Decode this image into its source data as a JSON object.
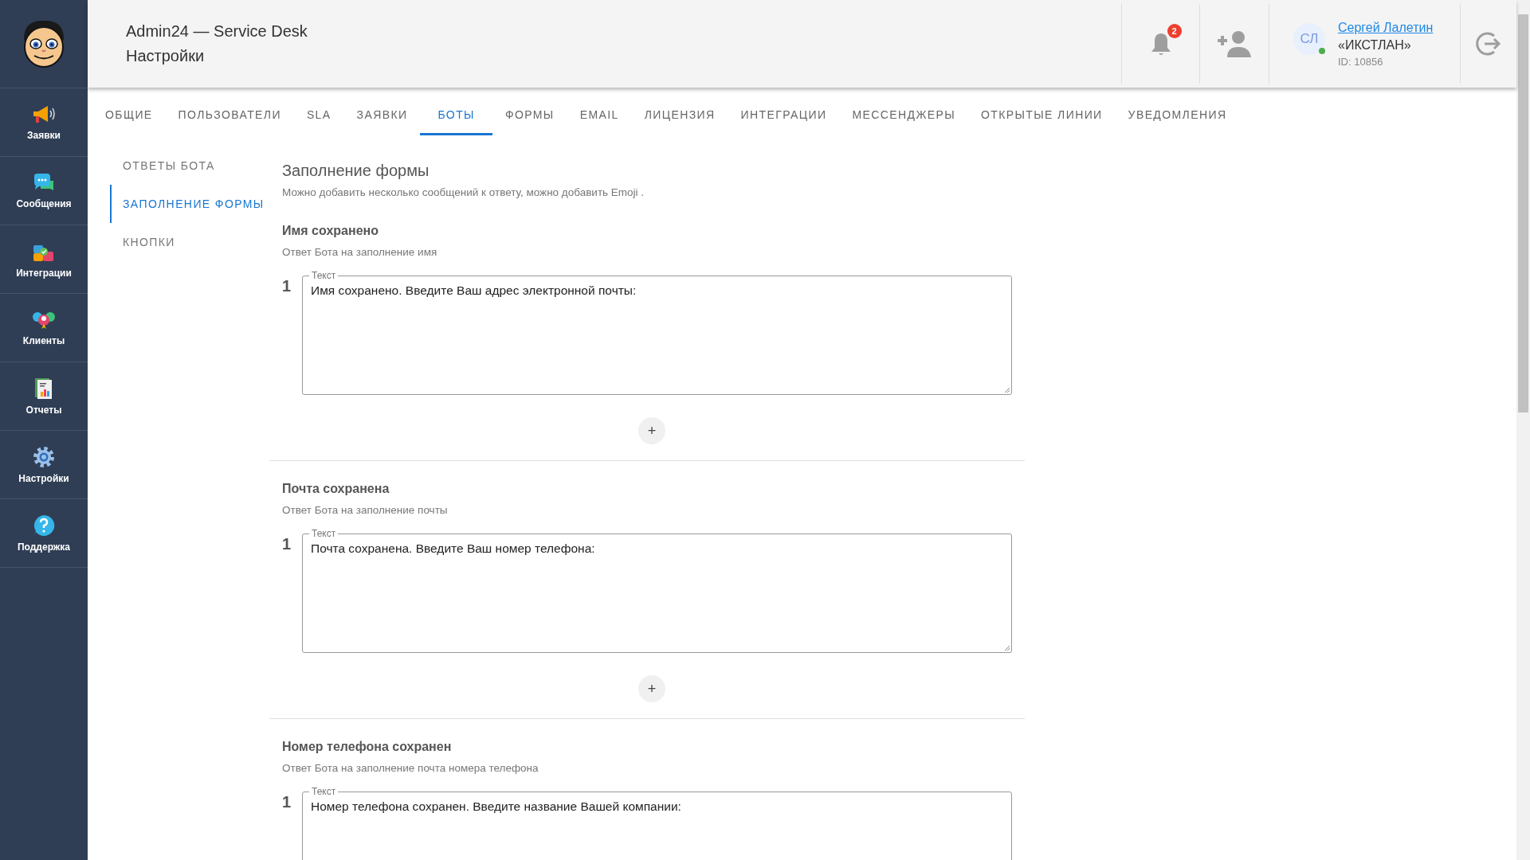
{
  "app": {
    "title": "Admin24 — Service Desk",
    "subtitle": "Настройки"
  },
  "sidebar": {
    "items": [
      {
        "label": "Заявки",
        "kind": "megaphone"
      },
      {
        "label": "Сообщения",
        "kind": "chat"
      },
      {
        "label": "Интеграции",
        "kind": "puzzle"
      },
      {
        "label": "Клиенты",
        "kind": "people"
      },
      {
        "label": "Отчеты",
        "kind": "report"
      },
      {
        "label": "Настройки",
        "kind": "gear"
      },
      {
        "label": "Поддержка",
        "kind": "help"
      }
    ]
  },
  "header": {
    "notifications_count": "2",
    "user": {
      "initials": "СЛ",
      "name": "Сергей Лалетин",
      "company": "«ИКСТЛАН»",
      "id": "ID: 10856",
      "online": true
    }
  },
  "tabs": [
    {
      "label": "ОБЩИЕ",
      "selected": false
    },
    {
      "label": "ПОЛЬЗОВАТЕЛИ",
      "selected": false
    },
    {
      "label": "SLA",
      "selected": false
    },
    {
      "label": "ЗАЯВКИ",
      "selected": false
    },
    {
      "label": "БОТЫ",
      "selected": true
    },
    {
      "label": "ФОРМЫ",
      "selected": false
    },
    {
      "label": "EMAIL",
      "selected": false
    },
    {
      "label": "ЛИЦЕНЗИЯ",
      "selected": false
    },
    {
      "label": "ИНТЕГРАЦИИ",
      "selected": false
    },
    {
      "label": "МЕССЕНДЖЕРЫ",
      "selected": false
    },
    {
      "label": "ОТКРЫТЫЕ ЛИНИИ",
      "selected": false
    },
    {
      "label": "УВЕДОМЛЕНИЯ",
      "selected": false
    }
  ],
  "subnav": [
    {
      "label": "ОТВЕТЫ БОТА",
      "selected": false
    },
    {
      "label": "ЗАПОЛНЕНИЕ ФОРМЫ",
      "selected": true
    },
    {
      "label": "КНОПКИ",
      "selected": false
    }
  ],
  "section": {
    "title": "Заполнение формы",
    "description": "Можно добавить несколько сообщений к ответу, можно добавить Emoji .",
    "blocks": [
      {
        "title": "Имя сохранено",
        "hint": "Ответ Бота на заполнение имя",
        "add_label": "+",
        "entries": [
          {
            "number": "1",
            "label": "Текст",
            "value": "Имя сохранено. Введите Ваш адрес электронной почты:"
          }
        ]
      },
      {
        "title": "Почта сохранена",
        "hint": "Ответ Бота на заполнение почты",
        "add_label": "+",
        "entries": [
          {
            "number": "1",
            "label": "Текст",
            "value": "Почта сохранена. Введите Ваш номер телефона:"
          }
        ]
      },
      {
        "title": "Номер телефона сохранен",
        "hint": "Ответ Бота на заполнение почта номера телефона",
        "entries": [
          {
            "number": "1",
            "label": "Текст",
            "value": "Номер телефона сохранен. Введите название Вашей компании:"
          }
        ]
      }
    ]
  }
}
